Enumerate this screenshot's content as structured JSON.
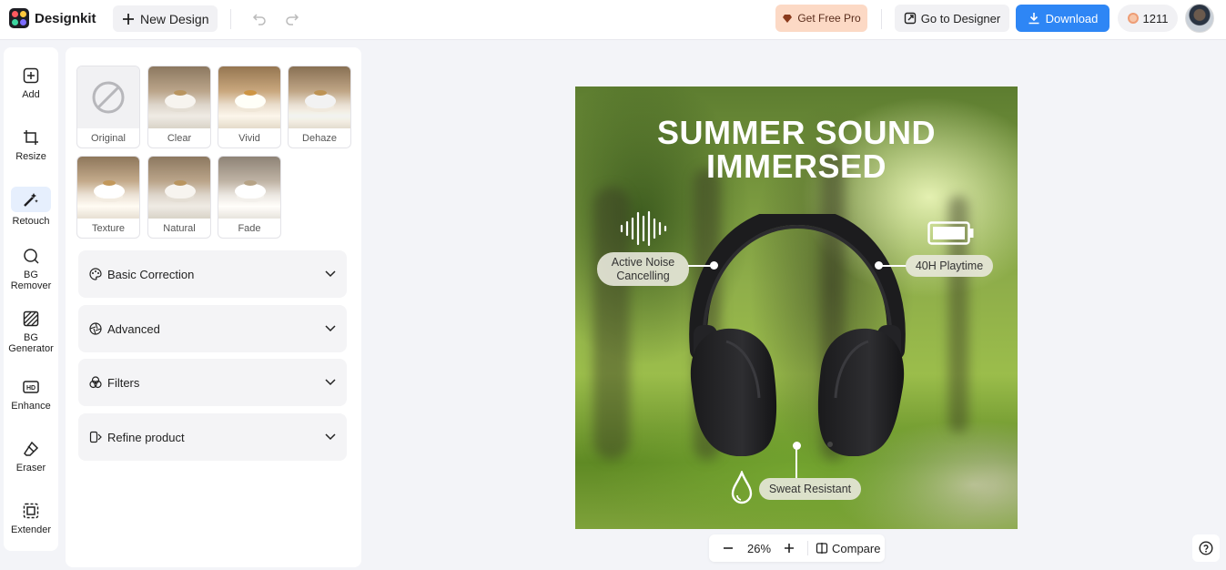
{
  "app": {
    "name": "Designkit"
  },
  "header": {
    "new_design_label": "New Design",
    "get_pro_label": "Get Free Pro",
    "go_to_designer_label": "Go to Designer",
    "download_label": "Download",
    "credits": "1211"
  },
  "sidebar": {
    "items": [
      {
        "label": "Add",
        "icon": "plus-square-icon"
      },
      {
        "label": "Resize",
        "icon": "crop-icon"
      },
      {
        "label": "Retouch",
        "icon": "magic-wand-icon",
        "active": true
      },
      {
        "label": "BG Remover",
        "icon": "bg-remover-icon"
      },
      {
        "label": "BG Generator",
        "icon": "bg-generator-icon"
      },
      {
        "label": "Enhance",
        "icon": "hd-icon"
      },
      {
        "label": "Eraser",
        "icon": "eraser-icon"
      },
      {
        "label": "Extender",
        "icon": "extender-icon"
      }
    ]
  },
  "presets": [
    "Original",
    "Clear",
    "Vivid",
    "Dehaze",
    "Texture",
    "Natural",
    "Fade"
  ],
  "sections": [
    {
      "label": "Basic Correction",
      "icon": "palette-icon"
    },
    {
      "label": "Advanced",
      "icon": "aperture-icon"
    },
    {
      "label": "Filters",
      "icon": "filters-icon"
    },
    {
      "label": "Refine product",
      "icon": "refine-product-icon"
    }
  ],
  "canvas": {
    "headline_line1": "SUMMER SOUND",
    "headline_line2": "IMMERSED",
    "feature_anc_line1": "Active Noise",
    "feature_anc_line2": "Cancelling",
    "feature_playtime": "40H Playtime",
    "feature_sweat": "Sweat Resistant"
  },
  "zoom": {
    "level": "26%",
    "compare_label": "Compare"
  },
  "colors": {
    "accent": "#2e86f5",
    "pro_bg": "#fcd9c5",
    "active_nav_bg": "#e6effd"
  }
}
